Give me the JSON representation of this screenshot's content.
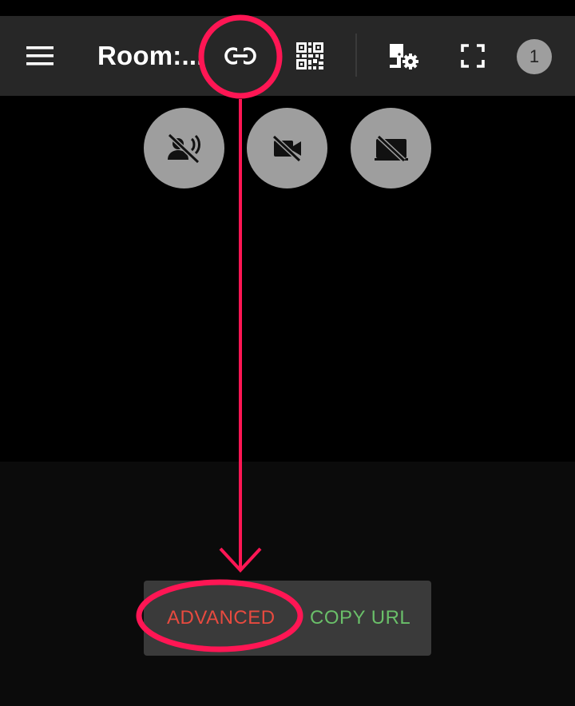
{
  "header": {
    "title": "Room:...",
    "participant_count": "1",
    "icons": {
      "menu": "menu-icon",
      "link": "link-icon",
      "qr": "qr-code-icon",
      "room_settings": "room-settings-icon",
      "fullscreen": "fullscreen-icon"
    }
  },
  "media_controls": {
    "icons": [
      "mic-off-icon",
      "videocam-off-icon",
      "screen-share-off-icon"
    ]
  },
  "snackbar": {
    "advanced_label": "ADVANCED",
    "copy_url_label": "COPY URL"
  },
  "colors": {
    "toolbar_bg": "#272727",
    "button_gray": "#9e9e9e",
    "advanced": "#e84a3f",
    "copy_url": "#6abf69",
    "annotation": "#ff1654"
  }
}
